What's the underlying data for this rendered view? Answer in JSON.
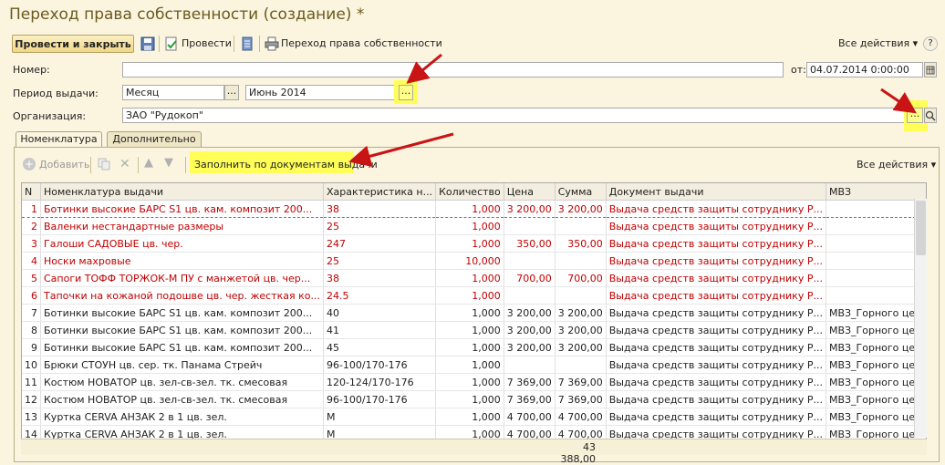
{
  "window": {
    "title": "Переход права собственности (создание) *"
  },
  "toolbar": {
    "post_close": "Провести и закрыть",
    "post": "Провести",
    "print": "Переход права собственности",
    "all_actions": "Все действия"
  },
  "form": {
    "number_label": "Номер:",
    "number_value": "",
    "date_label": "от:",
    "date_value": "04.07.2014  0:00:00",
    "period_label": "Период выдачи:",
    "period_type": "Месяц",
    "period_value": "Июнь 2014",
    "org_label": "Организация:",
    "org_value": "ЗАО \"Рудокоп\"",
    "ellipsis": "..."
  },
  "tabs": [
    {
      "label": "Номенклатура"
    },
    {
      "label": "Дополнительно"
    }
  ],
  "table_toolbar": {
    "add": "Добавить",
    "fill": "Заполнить по документам выдачи",
    "all_actions": "Все действия"
  },
  "table": {
    "columns": [
      "N",
      "Номенклатура выдачи",
      "Характеристика н...",
      "Количество",
      "Цена",
      "Сумма",
      "Документ выдачи",
      "МВЗ"
    ],
    "rows": [
      {
        "red": true,
        "cells": [
          "1",
          "Ботинки высокие БАРС S1 цв. кам. композит 200...",
          "38",
          "1,000",
          "3 200,00",
          "3 200,00",
          "Выдача средств защиты сотруднику Р...",
          ""
        ]
      },
      {
        "red": true,
        "cells": [
          "2",
          "Валенки нестандартные размеры",
          "25",
          "1,000",
          "",
          "",
          "Выдача средств защиты сотруднику Р...",
          ""
        ]
      },
      {
        "red": true,
        "cells": [
          "3",
          "Галоши САДОВЫЕ цв. чер.",
          "247",
          "1,000",
          "350,00",
          "350,00",
          "Выдача средств защиты сотруднику Р...",
          ""
        ]
      },
      {
        "red": true,
        "cells": [
          "4",
          "Носки махровые",
          "25",
          "10,000",
          "",
          "",
          "Выдача средств защиты сотруднику Р...",
          ""
        ]
      },
      {
        "red": true,
        "cells": [
          "5",
          "Сапоги ТОФФ ТОРЖОК-М ПУ с манжетой цв. чер...",
          "38",
          "1,000",
          "700,00",
          "700,00",
          "Выдача средств защиты сотруднику Р...",
          ""
        ]
      },
      {
        "red": true,
        "cells": [
          "6",
          "Тапочки на кожаной подошве цв. чер. жесткая ко...",
          "24.5",
          "1,000",
          "",
          "",
          "Выдача средств защиты сотруднику Р...",
          ""
        ]
      },
      {
        "red": false,
        "cells": [
          "7",
          "Ботинки высокие БАРС S1 цв. кам. композит 200...",
          "40",
          "1,000",
          "3 200,00",
          "3 200,00",
          "Выдача средств защиты сотруднику Р...",
          "МВЗ_Горного цеха"
        ]
      },
      {
        "red": false,
        "cells": [
          "8",
          "Ботинки высокие БАРС S1 цв. кам. композит 200...",
          "41",
          "1,000",
          "3 200,00",
          "3 200,00",
          "Выдача средств защиты сотруднику Р...",
          "МВЗ_Горного цеха"
        ]
      },
      {
        "red": false,
        "cells": [
          "9",
          "Ботинки высокие БАРС S1 цв. кам. композит 200...",
          "45",
          "1,000",
          "3 200,00",
          "3 200,00",
          "Выдача средств защиты сотруднику Р...",
          "МВЗ_Горного цеха"
        ]
      },
      {
        "red": false,
        "cells": [
          "10",
          "Брюки СТОУН цв. сер. тк. Панама Стрейч",
          "96-100/170-176",
          "1,000",
          "",
          "",
          "Выдача средств защиты сотруднику Р...",
          "МВЗ_Горного цеха"
        ]
      },
      {
        "red": false,
        "cells": [
          "11",
          "Костюм НОВАТОР цв. зел-св-зел. тк. смесовая",
          "120-124/170-176",
          "1,000",
          "7 369,00",
          "7 369,00",
          "Выдача средств защиты сотруднику Р...",
          "МВЗ_Горного цеха"
        ]
      },
      {
        "red": false,
        "cells": [
          "12",
          "Костюм НОВАТОР цв. зел-св-зел. тк. смесовая",
          "96-100/170-176",
          "1,000",
          "7 369,00",
          "7 369,00",
          "Выдача средств защиты сотруднику Р...",
          "МВЗ_Горного цеха"
        ]
      },
      {
        "red": false,
        "cells": [
          "13",
          "Куртка CERVA АНЗАК 2 в 1 цв. зел.",
          "M",
          "1,000",
          "4 700,00",
          "4 700,00",
          "Выдача средств защиты сотруднику Р...",
          "МВЗ_Горного цеха"
        ]
      },
      {
        "red": false,
        "cells": [
          "14",
          "Куртка CERVA АНЗАК 2 в 1 цв. зел.",
          "M",
          "1,000",
          "4 700,00",
          "4 700,00",
          "Выдача средств защиты сотруднику Р...",
          "МВЗ_Горного цеха"
        ]
      }
    ],
    "total_sum": "43 388,00"
  },
  "colors": {
    "highlight": "#ffff57",
    "arrow": "#c81414",
    "error_text": "#c00000"
  }
}
